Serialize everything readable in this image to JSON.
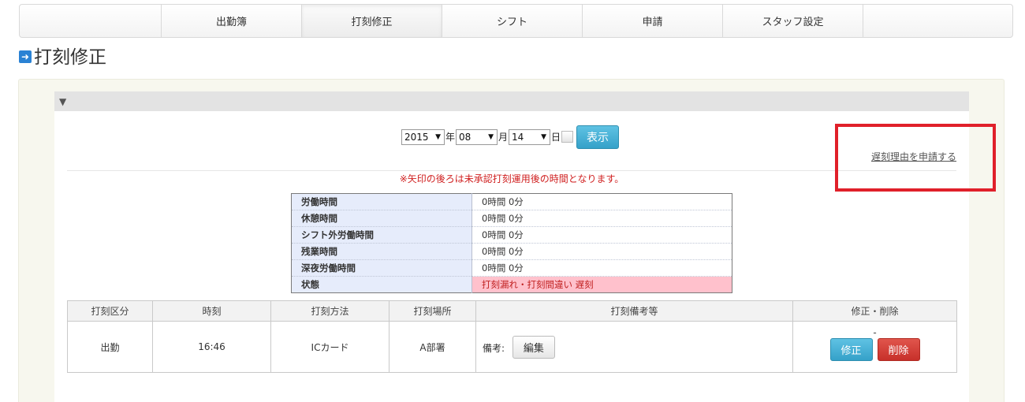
{
  "nav": {
    "items": [
      "出勤簿",
      "打刻修正",
      "シフト",
      "申請",
      "スタッフ設定"
    ],
    "active_index": 1
  },
  "page": {
    "title": "打刻修正"
  },
  "panel": {
    "collapse_icon": "▼",
    "date": {
      "year": "2015",
      "year_unit": "年",
      "month": "08",
      "month_unit": "月",
      "day": "14",
      "day_unit": "日",
      "show_button": "表示"
    },
    "late_link": "遅刻理由を申請する",
    "notice": "※矢印の後ろは未承認打刻運用後の時間となります。"
  },
  "summary": {
    "rows": [
      {
        "label": "労働時間",
        "value": "0時間 0分"
      },
      {
        "label": "休憩時間",
        "value": "0時間 0分"
      },
      {
        "label": "シフト外労働時間",
        "value": "0時間 0分"
      },
      {
        "label": "残業時間",
        "value": "0時間 0分"
      },
      {
        "label": "深夜労働時間",
        "value": "0時間 0分"
      },
      {
        "label": "状態",
        "value": "打刻漏れ・打刻間違い 遅刻"
      }
    ]
  },
  "punch": {
    "headers": [
      "打刻区分",
      "時刻",
      "打刻方法",
      "打刻場所",
      "打刻備考等",
      "修正・削除"
    ],
    "row": {
      "type": "出勤",
      "time": "16:46",
      "method": "ICカード",
      "place": "A部署",
      "memo_label": "備考:",
      "edit_button": "編集",
      "dash": "-",
      "fix_button": "修正",
      "delete_button": "削除"
    }
  },
  "colors": {
    "accent": "#35a1c9",
    "danger": "#c7302a",
    "highlight": "#e0202a",
    "status_bg": "#ffc1cc"
  }
}
